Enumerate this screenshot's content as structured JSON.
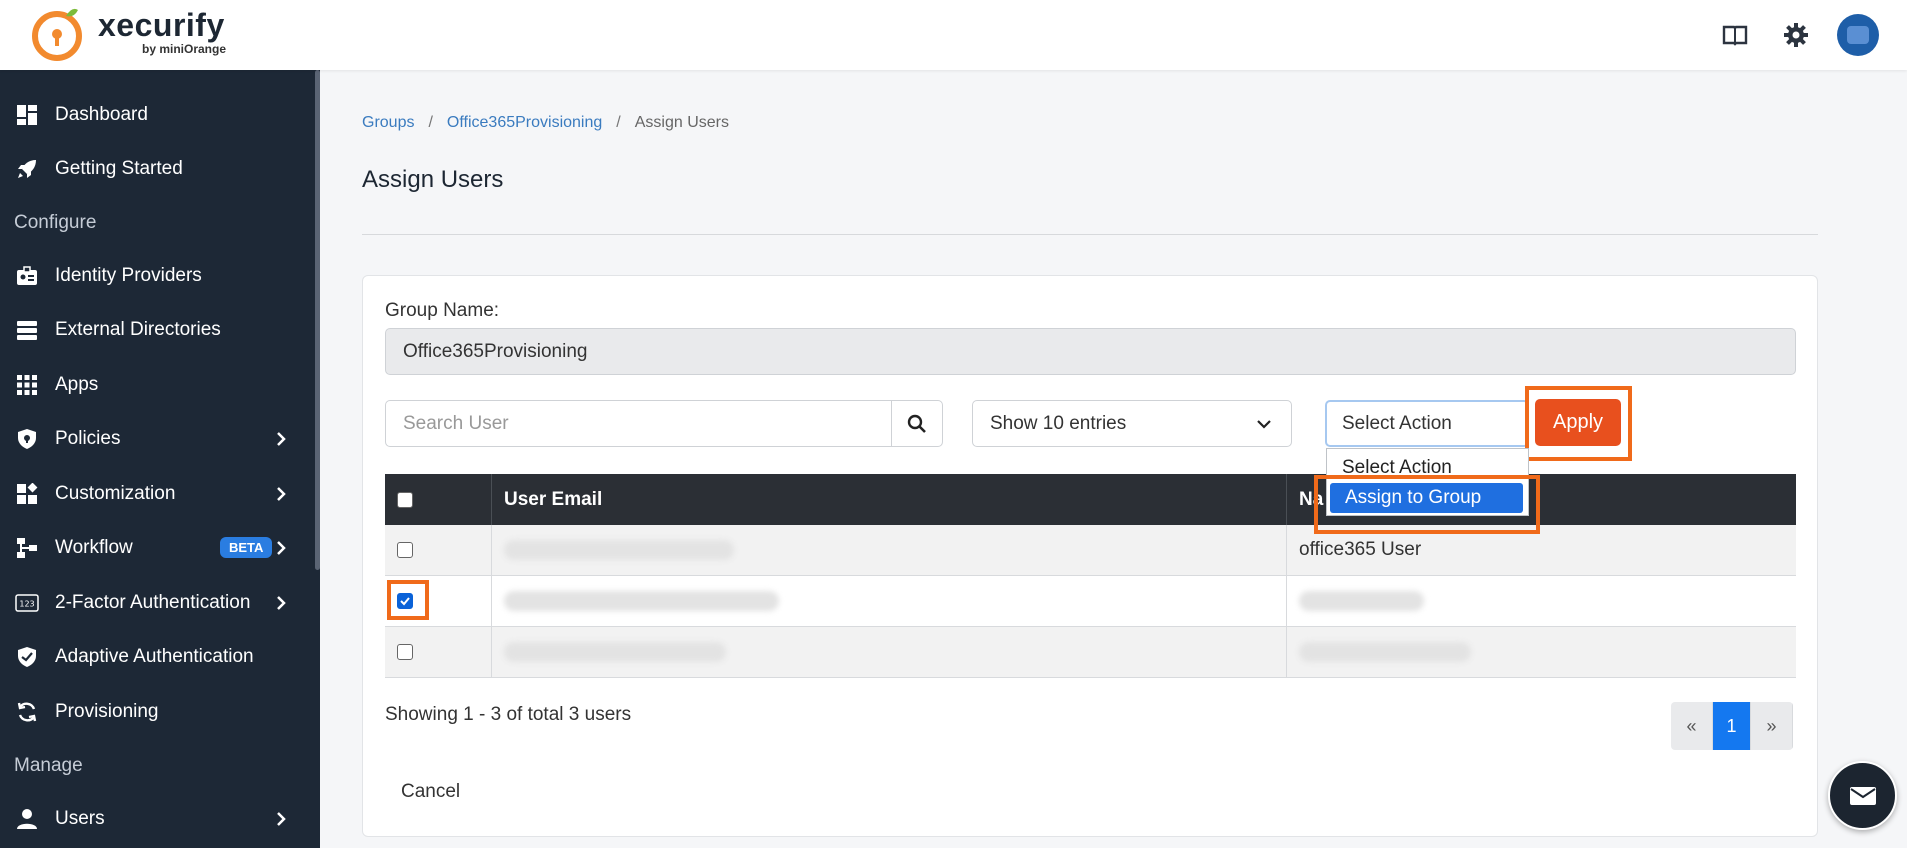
{
  "brand": {
    "name": "xecurify",
    "sub": "by miniOrange"
  },
  "sidebar": {
    "items": [
      {
        "label": "Dashboard",
        "icon": "dashboard-icon"
      },
      {
        "label": "Getting Started",
        "icon": "rocket-icon"
      },
      {
        "label": "Identity Providers",
        "icon": "id-badge-icon"
      },
      {
        "label": "External Directories",
        "icon": "server-icon"
      },
      {
        "label": "Apps",
        "icon": "grid-icon"
      },
      {
        "label": "Policies",
        "icon": "shield-lock-icon"
      },
      {
        "label": "Customization",
        "icon": "puzzle-icon"
      },
      {
        "label": "Workflow",
        "icon": "workflow-icon",
        "badge": "BETA"
      },
      {
        "label": "2-Factor Authentication",
        "icon": "123-icon"
      },
      {
        "label": "Adaptive Authentication",
        "icon": "shield-check-icon"
      },
      {
        "label": "Provisioning",
        "icon": "sync-icon"
      },
      {
        "label": "Users",
        "icon": "user-icon"
      }
    ],
    "sections": {
      "configure": "Configure",
      "manage": "Manage"
    }
  },
  "breadcrumb": {
    "groups": "Groups",
    "group": "Office365Provisioning",
    "current": "Assign Users",
    "sep": "/"
  },
  "page": {
    "title": "Assign Users"
  },
  "form": {
    "group_label": "Group Name:",
    "group_value": "Office365Provisioning",
    "search_placeholder": "Search User",
    "entries": "Show 10 entries",
    "action": "Select Action",
    "apply": "Apply",
    "dropdown": [
      "Select Action",
      "Assign to Group"
    ]
  },
  "table": {
    "headers": [
      "",
      "User Email",
      "Na"
    ],
    "rows": [
      {
        "email": "",
        "name": "office365 User",
        "checked": false
      },
      {
        "email": "",
        "name": "",
        "checked": true
      },
      {
        "email": "",
        "name": "",
        "checked": false
      }
    ]
  },
  "footer": {
    "showing": "Showing 1 - 3 of total 3 users",
    "pager_prev": "«",
    "pager_page": "1",
    "pager_next": "»",
    "cancel": "Cancel"
  },
  "colors": {
    "accent": "#e8501e",
    "highlight": "#f06a1a",
    "sidebar": "#1d2836",
    "primary": "#1478f0"
  }
}
